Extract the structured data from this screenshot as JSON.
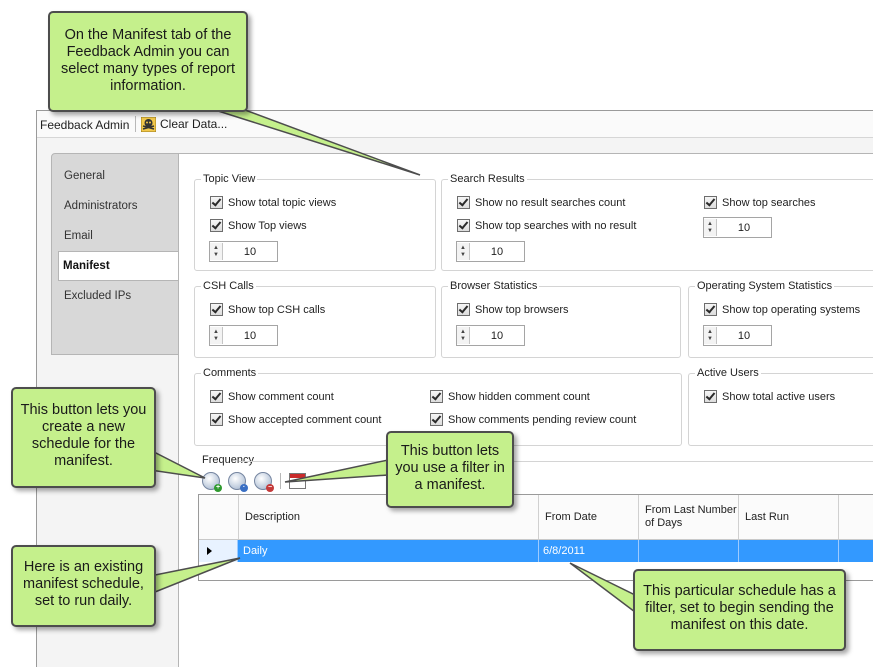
{
  "toolbar": {
    "title": "Feedback Admin",
    "clear_label": "Clear Data..."
  },
  "sidebar": {
    "tabs": [
      "General",
      "Administrators",
      "Email",
      "Manifest",
      "Excluded IPs"
    ],
    "active": "Manifest"
  },
  "groups": {
    "topic_view": {
      "title": "Topic View",
      "options": [
        "Show total topic views",
        "Show Top views"
      ],
      "spin": "10"
    },
    "search_results": {
      "title": "Search Results",
      "options": [
        "Show no result searches count",
        "Show top searches with no result"
      ],
      "spin": "10",
      "options_right": [
        "Show top searches"
      ],
      "spin_right": "10"
    },
    "csh_calls": {
      "title": "CSH Calls",
      "options": [
        "Show top CSH calls"
      ],
      "spin": "10"
    },
    "browser_statistics": {
      "title": "Browser Statistics",
      "options": [
        "Show top browsers"
      ],
      "spin": "10"
    },
    "os_statistics": {
      "title": "Operating System Statistics",
      "options": [
        "Show top operating systems"
      ],
      "spin": "10"
    },
    "comments": {
      "title": "Comments",
      "options": [
        "Show comment count",
        "Show accepted comment count",
        "Show hidden comment count",
        "Show comments pending review count"
      ]
    },
    "active_users": {
      "title": "Active Users",
      "options": [
        "Show total active users"
      ]
    }
  },
  "frequency": {
    "label": "Frequency",
    "columns": [
      "Description",
      "From Date",
      "From Last Number of Days",
      "Last Run"
    ],
    "rows": [
      {
        "description": "Daily",
        "from_date": "6/8/2011",
        "from_last": "",
        "last_run": ""
      }
    ]
  },
  "callouts": {
    "manifest_tab": "On the Manifest tab of the Feedback Admin you can select many types of report information.",
    "new_schedule": "This button lets you create a new schedule for the manifest.",
    "filter": "This button lets you use a filter in a manifest.",
    "existing": "Here is an existing manifest schedule, set to run daily.",
    "date": "This particular schedule has a filter, set to begin sending the manifest on this date."
  },
  "colors": {
    "callout_fill": "#c5f08c",
    "selection": "#3399ff"
  }
}
